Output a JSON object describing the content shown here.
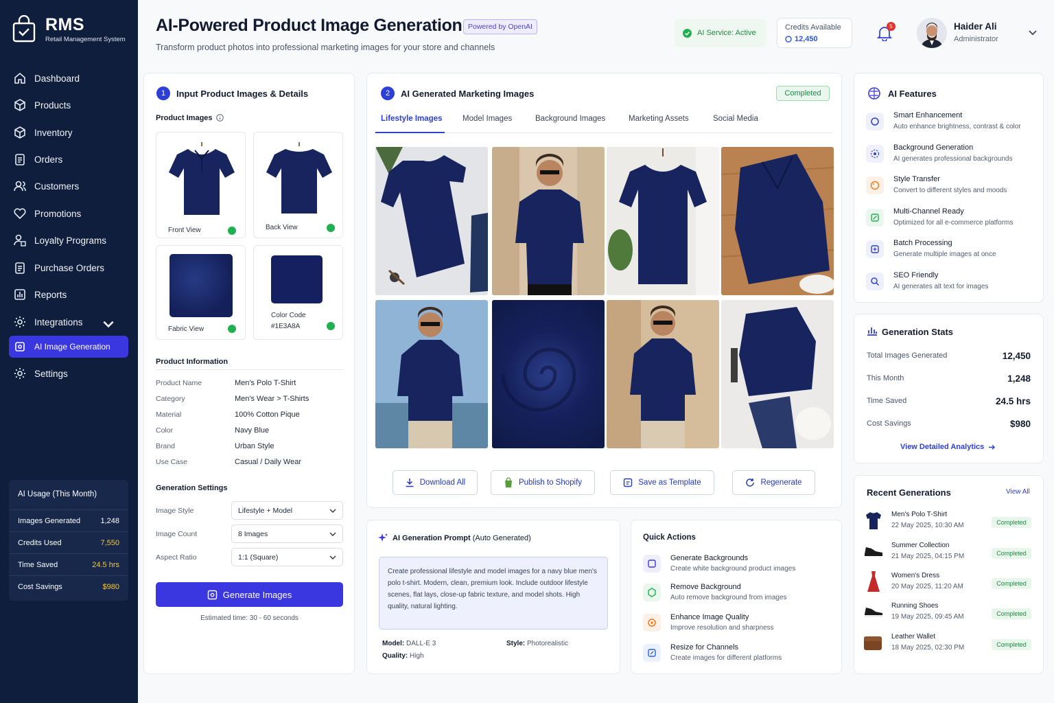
{
  "app": {
    "name": "RMS",
    "subtitle": "Retail Management System"
  },
  "nav": [
    {
      "label": "Dashboard",
      "icon": "home-icon"
    },
    {
      "label": "Products",
      "icon": "box-icon"
    },
    {
      "label": "Inventory",
      "icon": "cube-icon"
    },
    {
      "label": "Orders",
      "icon": "clipboard-icon"
    },
    {
      "label": "Customers",
      "icon": "users-icon"
    },
    {
      "label": "Promotions",
      "icon": "heart-icon"
    },
    {
      "label": "Loyalty Programs",
      "icon": "gift-user-icon"
    },
    {
      "label": "Purchase Orders",
      "icon": "document-icon"
    },
    {
      "label": "Reports",
      "icon": "bar-chart-icon"
    },
    {
      "label": "Integrations",
      "icon": "gear-icon"
    },
    {
      "label": "AI Image Generation",
      "icon": "image-ai-icon"
    },
    {
      "label": "Settings",
      "icon": "settings-icon"
    }
  ],
  "usage": {
    "title": "AI Usage (This Month)",
    "rows": [
      {
        "label": "Images Generated",
        "value": "1,248"
      },
      {
        "label": "Credits Used",
        "value": "7,550"
      },
      {
        "label": "Time Saved",
        "value": "24.5 hrs"
      },
      {
        "label": "Cost Savings",
        "value": "$980"
      }
    ]
  },
  "header": {
    "title": "AI-Powered Product Image Generation",
    "badge": "Powered by OpenAI",
    "subtitle": "Transform product photos into professional marketing images for your store and channels",
    "service": "AI Service: Active",
    "credits_label": "Credits Available",
    "credits_value": "12,450",
    "notifications": "5",
    "user_name": "Haider Ali",
    "user_role": "Administrator"
  },
  "input": {
    "step": "1",
    "title": "Input Product Images & Details",
    "images_label": "Product Images",
    "thumbs": [
      "Front View",
      "Back View",
      "Fabric View",
      "Color Code"
    ],
    "color_hex": "#1E3A8A",
    "info_title": "Product Information",
    "info": [
      {
        "label": "Product Name",
        "value": "Men's Polo T-Shirt"
      },
      {
        "label": "Category",
        "value": "Men's Wear > T-Shirts"
      },
      {
        "label": "Material",
        "value": "100% Cotton Pique"
      },
      {
        "label": "Color",
        "value": "Navy Blue"
      },
      {
        "label": "Brand",
        "value": "Urban Style"
      },
      {
        "label": "Use Case",
        "value": "Casual / Daily Wear"
      }
    ],
    "settings_title": "Generation Settings",
    "settings": [
      {
        "label": "Image Style",
        "value": "Lifestyle + Model"
      },
      {
        "label": "Image Count",
        "value": "8 Images"
      },
      {
        "label": "Aspect Ratio",
        "value": "1:1 (Square)"
      }
    ],
    "generate": "Generate Images",
    "estimate": "Estimated time: 30 - 60 seconds"
  },
  "output": {
    "step": "2",
    "title": "AI Generated Marketing Images",
    "status": "Completed",
    "tabs": [
      "Lifestyle Images",
      "Model Images",
      "Background Images",
      "Marketing Assets",
      "Social Media"
    ],
    "actions": [
      "Download All",
      "Publish to Shopify",
      "Save as Template",
      "Regenerate"
    ]
  },
  "prompt": {
    "title": "AI Generation Prompt",
    "title_suffix": "(Auto Generated)",
    "text": "Create professional lifestyle and model images for a navy blue men's polo t-shirt. Modern, clean, premium look. Include outdoor lifestyle scenes, flat lays, close-up fabric texture, and model shots. High quality, natural lighting.",
    "model_k": "Model:",
    "model_v": "DALL-E 3",
    "style_k": "Style:",
    "style_v": "Photorealistic",
    "quality_k": "Quality:",
    "quality_v": "High"
  },
  "quick": {
    "title": "Quick Actions",
    "items": [
      {
        "t": "Generate Backgrounds",
        "d": "Create white background product images"
      },
      {
        "t": "Remove Background",
        "d": "Auto remove background from images"
      },
      {
        "t": "Enhance Image Quality",
        "d": "Improve resolution and sharpness"
      },
      {
        "t": "Resize for Channels",
        "d": "Create images for different platforms"
      }
    ]
  },
  "features": {
    "title": "AI Features",
    "items": [
      {
        "t": "Smart Enhancement",
        "d": "Auto enhance brightness, contrast & color"
      },
      {
        "t": "Background Generation",
        "d": "AI generates professional backgrounds"
      },
      {
        "t": "Style Transfer",
        "d": "Convert to different styles and moods"
      },
      {
        "t": "Multi-Channel Ready",
        "d": "Optimized for all e-commerce platforms"
      },
      {
        "t": "Batch Processing",
        "d": "Generate multiple images at once"
      },
      {
        "t": "SEO Friendly",
        "d": "AI generates alt text for images"
      }
    ]
  },
  "stats": {
    "title": "Generation Stats",
    "rows": [
      {
        "label": "Total Images Generated",
        "value": "12,450"
      },
      {
        "label": "This Month",
        "value": "1,248"
      },
      {
        "label": "Time Saved",
        "value": "24.5 hrs"
      },
      {
        "label": "Cost Savings",
        "value": "$980"
      }
    ],
    "link": "View Detailed Analytics"
  },
  "recent": {
    "title": "Recent Generations",
    "view_all": "View All",
    "items": [
      {
        "t": "Men's Polo T-Shirt",
        "d": "22 May 2025, 10:30 AM",
        "s": "Completed"
      },
      {
        "t": "Summer Collection",
        "d": "21 May 2025, 04:15 PM",
        "s": "Completed"
      },
      {
        "t": "Women's Dress",
        "d": "20 May 2025, 11:20 AM",
        "s": "Completed"
      },
      {
        "t": "Running Shoes",
        "d": "19 May 2025, 09:45 AM",
        "s": "Completed"
      },
      {
        "t": "Leather Wallet",
        "d": "18 May 2025, 02:30 PM",
        "s": "Completed"
      }
    ]
  }
}
